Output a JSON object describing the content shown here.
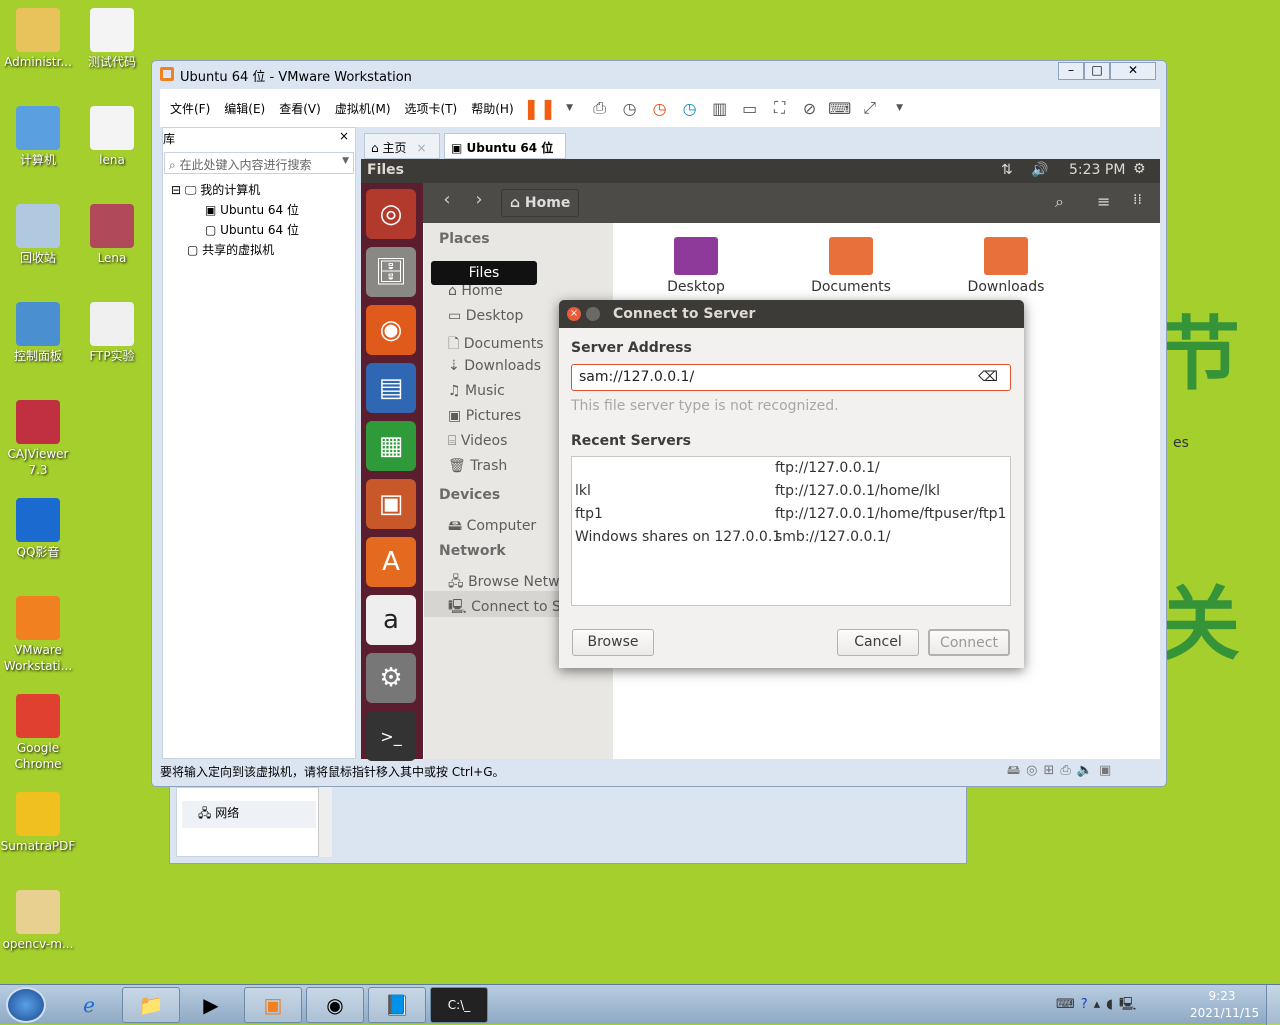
{
  "desktop": {
    "icons": [
      {
        "label": "Administr...",
        "x": "",
        "color": "#e8c25a"
      },
      {
        "label": "测试代码",
        "color": "#f4f4f4"
      },
      {
        "label": "计算机",
        "color": "#5aa0e0"
      },
      {
        "label": "lena",
        "color": "#f4f4f4"
      },
      {
        "label": "回收站",
        "color": "#b0c8e0"
      },
      {
        "label": "Lena",
        "color": "#b04a5a"
      },
      {
        "label": "控制面板",
        "color": "#4a90d0"
      },
      {
        "label": "FTP实验",
        "color": "#f0f0f0"
      },
      {
        "label": "CAJViewer 7.3",
        "color": "#c03040"
      },
      {
        "label": "QQ影音",
        "color": "#1a6ad0"
      },
      {
        "label": "VMware Workstati...",
        "color": "#f08020"
      },
      {
        "label": "Google Chrome",
        "color": "#e04030"
      },
      {
        "label": "SumatraPDF",
        "color": "#f0c020"
      },
      {
        "label": "opencv-m...",
        "color": "#e8d090"
      }
    ],
    "wallpaper_text": [
      "节",
      "关"
    ]
  },
  "vmware": {
    "title": "Ubuntu 64 位 - VMware Workstation",
    "menu": [
      "文件(F)",
      "编辑(E)",
      "查看(V)",
      "虚拟机(M)",
      "选项卡(T)",
      "帮助(H)"
    ],
    "library": {
      "title": "库",
      "close": "×",
      "search_placeholder": "在此处键入内容进行搜索",
      "tree": [
        "我的计算机",
        "Ubuntu 64 位",
        "Ubuntu 64 位",
        "共享的虚拟机"
      ]
    },
    "tabs": [
      {
        "label": "主页"
      },
      {
        "label": "Ubuntu 64 位"
      }
    ],
    "status": "要将输入定向到该虚拟机，请将鼠标指针移入其中或按 Ctrl+G。"
  },
  "behind_window": {
    "item": "网络"
  },
  "ubuntu": {
    "app": "Files",
    "time": "5:23 PM",
    "tooltip": "Files",
    "location": "Home",
    "places_header": "Places",
    "places": [
      "Home",
      "Desktop",
      "Documents",
      "Downloads",
      "Music",
      "Pictures",
      "Videos",
      "Trash"
    ],
    "devices_header": "Devices",
    "devices": [
      "Computer"
    ],
    "network_header": "Network",
    "network": [
      "Browse Network",
      "Connect to Server"
    ],
    "folders": [
      "Desktop",
      "Documents",
      "Downloads"
    ],
    "partial_label": "es"
  },
  "dialog": {
    "title": "Connect to Server",
    "address_label": "Server Address",
    "address_value": "sam://127.0.0.1/",
    "error": "This file server type is not recognized.",
    "recent_label": "Recent Servers",
    "recent": [
      {
        "name": "",
        "url": "ftp://127.0.0.1/"
      },
      {
        "name": "lkl",
        "url": "ftp://127.0.0.1/home/lkl"
      },
      {
        "name": "ftp1",
        "url": "ftp://127.0.0.1/home/ftpuser/ftp1"
      },
      {
        "name": "Windows shares on 127.0.0.1",
        "url": "smb://127.0.0.1/"
      }
    ],
    "browse": "Browse",
    "cancel": "Cancel",
    "connect": "Connect",
    "accent": "#e0542b"
  },
  "taskbar": {
    "time": "9:23",
    "date": "2021/11/15"
  }
}
